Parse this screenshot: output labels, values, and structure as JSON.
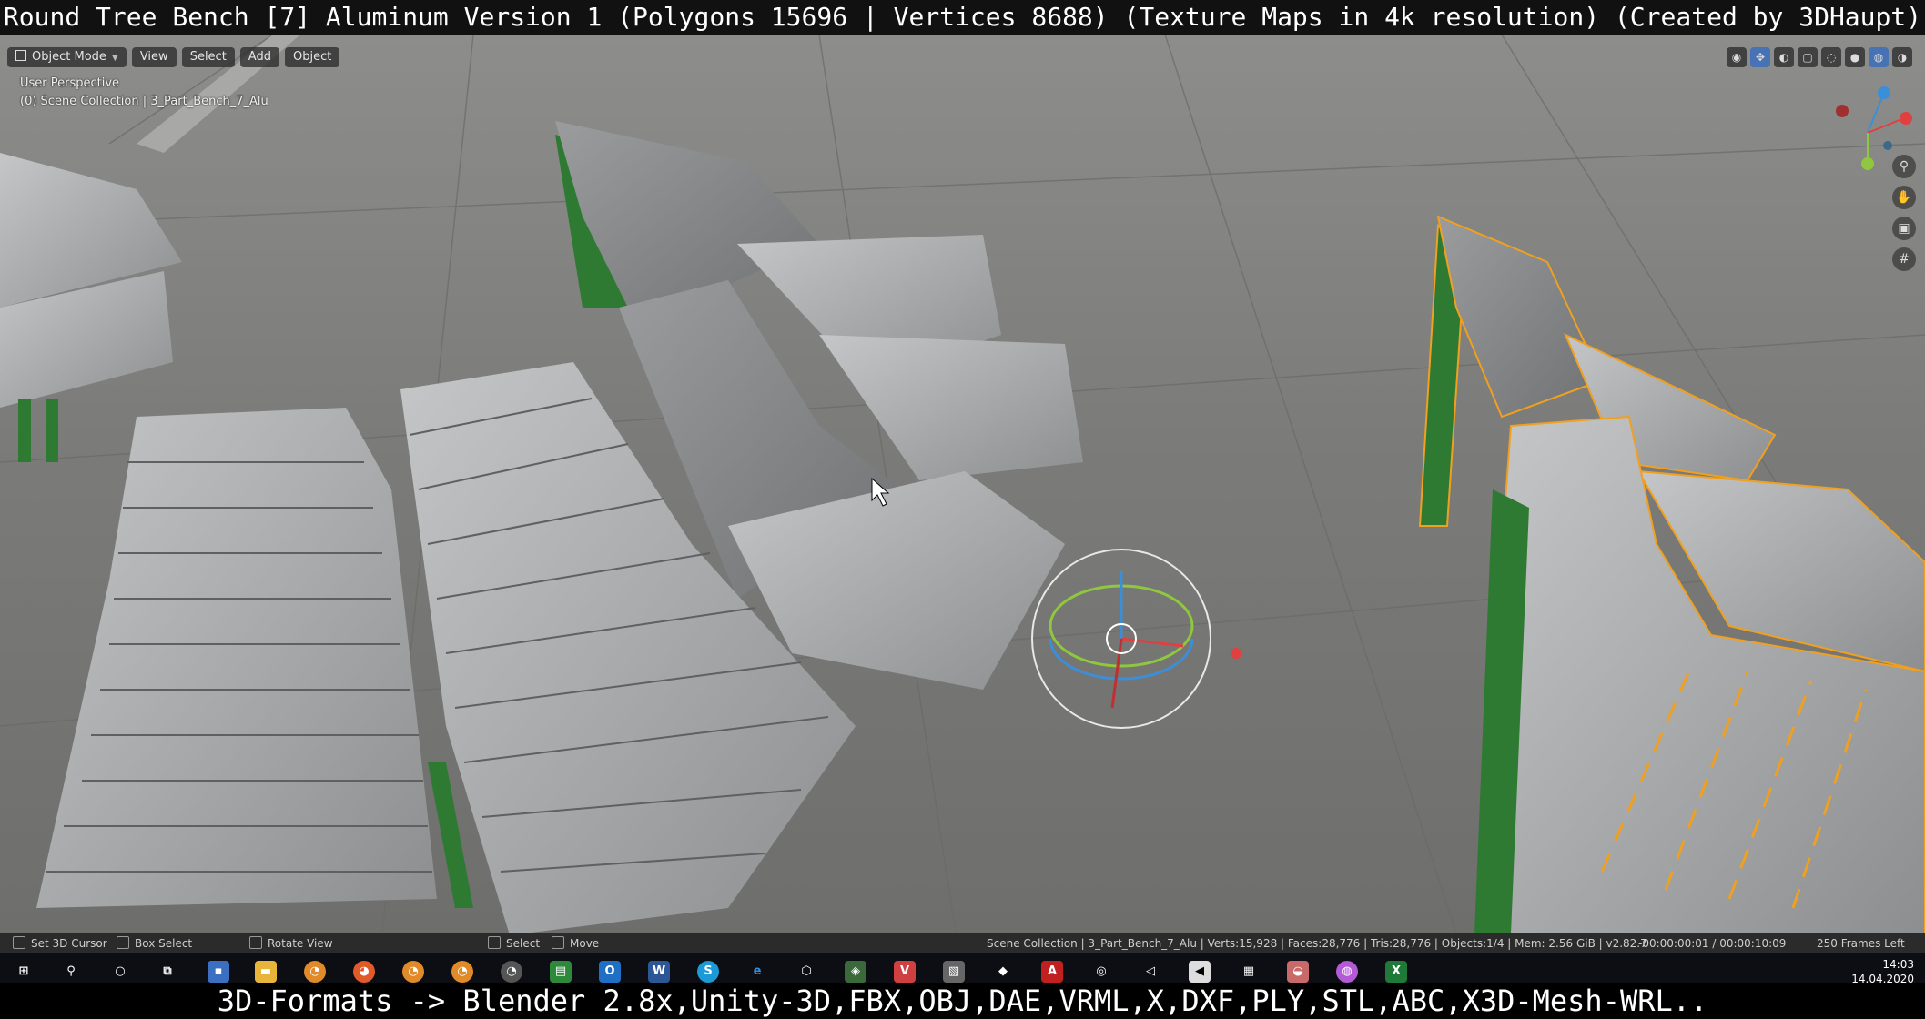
{
  "top_caption": "Round Tree Bench [7] Aluminum Version 1 (Polygons 15696 | Vertices 8688) (Texture Maps in 4k resolution) (Created by 3DHaupt)",
  "bottom_caption": "3D-Formats -> Blender 2.8x,Unity-3D,FBX,OBJ,DAE,VRML,X,DXF,PLY,STL,ABC,X3D-Mesh-WRL..",
  "viewport_header": {
    "mode": "Object Mode",
    "menus": [
      "View",
      "Select",
      "Add",
      "Object"
    ]
  },
  "viewport_overlay": {
    "perspective": "User Perspective",
    "collection": "(0) Scene Collection | 3_Part_Bench_7_Alu"
  },
  "navigation_icons": [
    "zoom-icon",
    "hand-pan-icon",
    "camera-icon",
    "grid-icon"
  ],
  "statusbar": {
    "left_items": [
      "Set 3D Cursor",
      "Box Select",
      "Rotate View",
      "Select",
      "Move"
    ],
    "scene_info": "Scene Collection | 3_Part_Bench_7_Alu | Verts:15,928 | Faces:28,776 | Tris:28,776 | Objects:1/4 | Mem: 2.56 GiB | v2.82.7",
    "timecode": "-00:00:00:01 / 00:00:10:09",
    "frames_left": "250 Frames Left"
  },
  "taskbar": {
    "time": "14:03",
    "date": "14.04.2020"
  },
  "colors": {
    "bench_frame": "#2f7a32",
    "selection_outline": "#f0a020",
    "slat_gray": "#a7a9ab",
    "ground": "#7d7d7b"
  }
}
